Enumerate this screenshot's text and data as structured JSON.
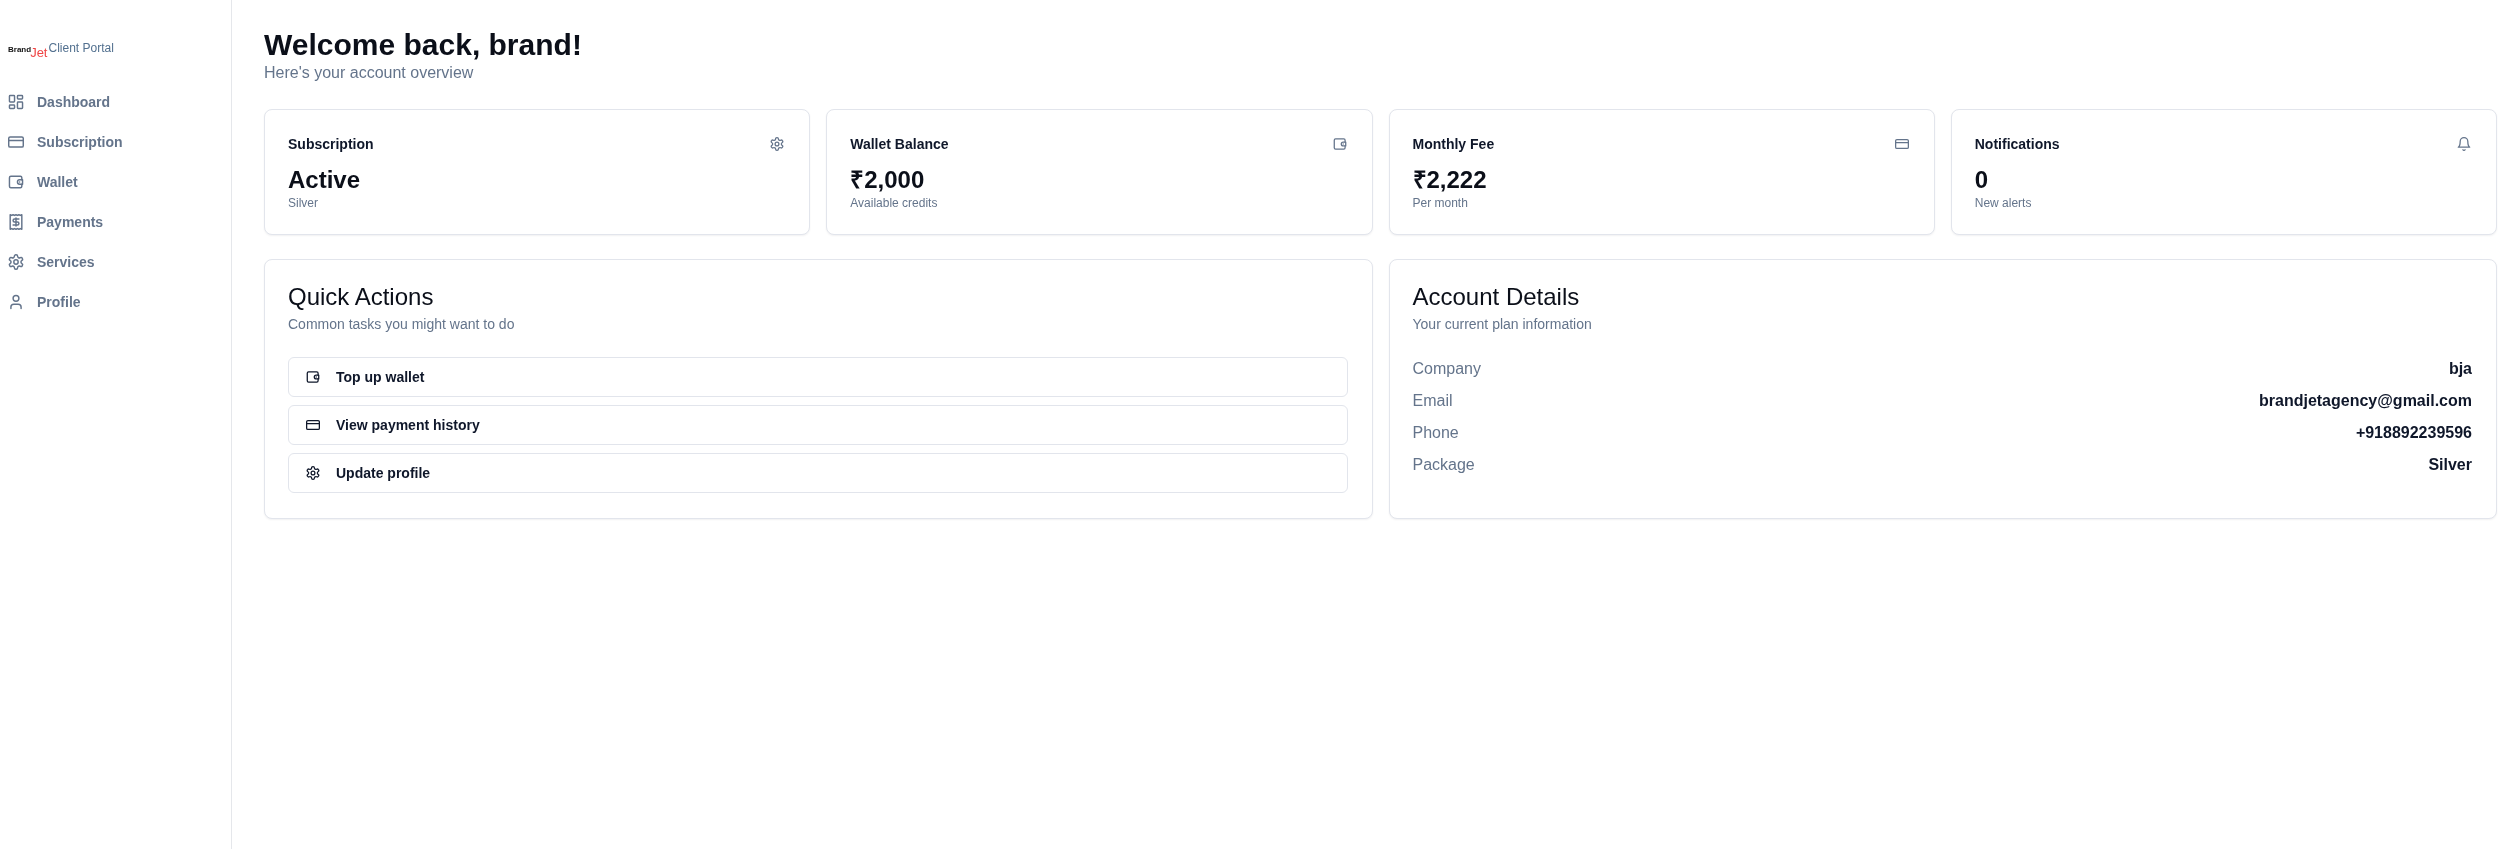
{
  "sidebar": {
    "logo": {
      "word": "Brand",
      "accent": "Jet"
    },
    "subtitle": "Client Portal",
    "items": [
      {
        "label": "Dashboard",
        "selected": false
      },
      {
        "label": "Subscription",
        "selected": false
      },
      {
        "label": "Wallet",
        "selected": false
      },
      {
        "label": "Payments",
        "selected": false
      },
      {
        "label": "Services",
        "selected": false
      },
      {
        "label": "Profile",
        "selected": false
      }
    ]
  },
  "header": {
    "title": "Welcome back, brand!",
    "subtitle": "Here's your account overview"
  },
  "stats": [
    {
      "title": "Subscription",
      "value": "Active",
      "caption": "Silver"
    },
    {
      "title": "Wallet Balance",
      "value": "₹2,000",
      "caption": "Available credits"
    },
    {
      "title": "Monthly Fee",
      "value": "₹2,222",
      "caption": "Per month"
    },
    {
      "title": "Notifications",
      "value": "0",
      "caption": "New alerts"
    }
  ],
  "quick_actions": {
    "title": "Quick Actions",
    "subtitle": "Common tasks you might want to do",
    "actions": [
      "Top up wallet",
      "View payment history",
      "Update profile"
    ]
  },
  "account_details": {
    "title": "Account Details",
    "subtitle": "Your current plan information",
    "rows": [
      {
        "label": "Company",
        "value": "bja"
      },
      {
        "label": "Email",
        "value": "brandjetagency@gmail.com"
      },
      {
        "label": "Phone",
        "value": "+918892239596"
      },
      {
        "label": "Package",
        "value": "Silver"
      }
    ]
  }
}
